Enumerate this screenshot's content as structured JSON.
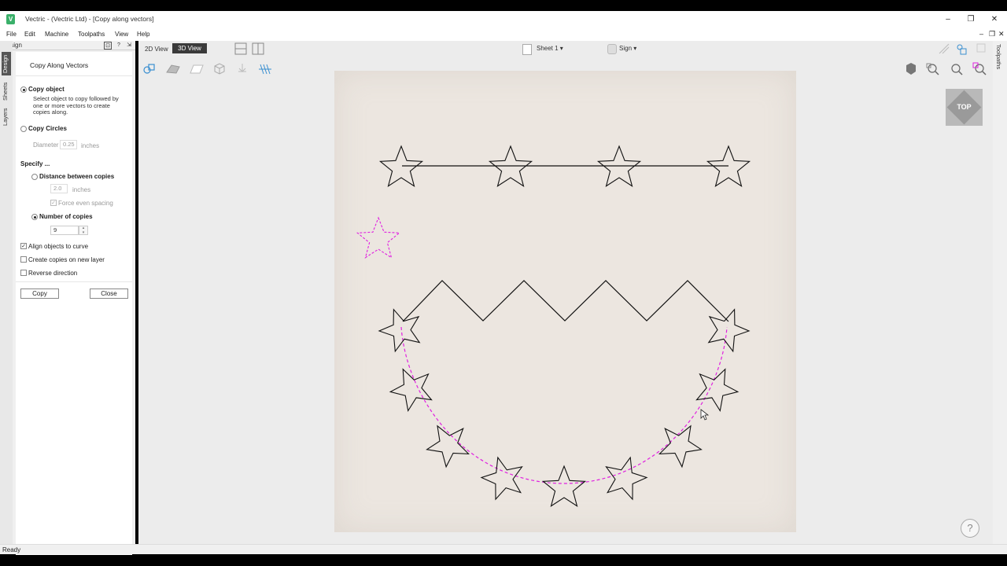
{
  "window": {
    "title": "Vectric - (Vectric Ltd) - [Copy along vectors]",
    "logo": "V",
    "min": "–",
    "restore": "❐",
    "close": "✕"
  },
  "menu": {
    "items": [
      "File",
      "Edit",
      "Machine",
      "Toolpaths",
      "View",
      "Help"
    ],
    "mdi_min": "–",
    "mdi_restore": "❐",
    "mdi_close": "✕"
  },
  "left_tabs": [
    "Design",
    "Sheets",
    "Layers"
  ],
  "panel": {
    "header": "Design",
    "header_buttons": [
      "⊡",
      "?",
      "⇲"
    ],
    "title": "Copy Along Vectors",
    "copy_object": {
      "label": "Copy object",
      "selected": true,
      "description": "Select object to copy followed by one or more vectors to create copies along."
    },
    "copy_circles": {
      "label": "Copy Circles",
      "selected": false,
      "diameter_label": "Diameter",
      "diameter_value": "0.25",
      "unit": "inches"
    },
    "specify_label": "Specify ...",
    "distance": {
      "label": "Distance between copies",
      "selected": false,
      "value": "2.0",
      "unit": "inches",
      "force_even_label": "Force even spacing",
      "force_even": true
    },
    "number": {
      "label": "Number of copies",
      "selected": true,
      "value": "9"
    },
    "align": {
      "label": "Align objects to curve",
      "checked": true
    },
    "new_layer": {
      "label": "Create copies on new layer",
      "checked": false
    },
    "reverse": {
      "label": "Reverse direction",
      "checked": false
    },
    "copy_btn": "Copy",
    "close_btn": "Close"
  },
  "view": {
    "tab_2d": "2D View",
    "tab_3d": "3D View",
    "sheet": "Sheet 1 ▾",
    "sign": "Sign ▾",
    "cube_label": "TOP",
    "help": "?",
    "right_tab": "Toolpaths"
  },
  "canvas": {
    "line_color": "#111111",
    "selected_color": "#e020e0",
    "copies_shown": 9
  },
  "status": "Ready",
  "colors": {
    "active_tab": "#3a3a3a",
    "material": "#ece6e0",
    "accent": "#3a8fd0"
  }
}
